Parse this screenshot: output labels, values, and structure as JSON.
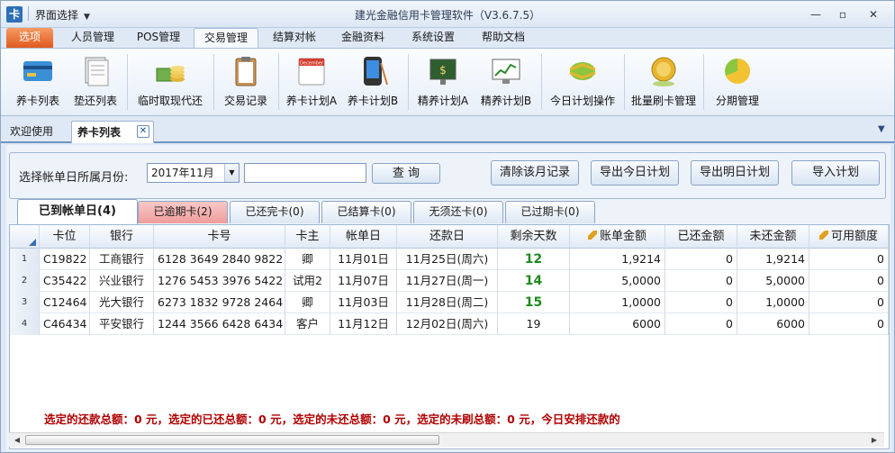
{
  "titlebar": {
    "switcher_label": "界面选择",
    "app_title": "建光金融信用卡管理软件（V3.6.7.5）",
    "icon_glyph": "卡"
  },
  "menu": {
    "options": "选项",
    "items": [
      "人员管理",
      "POS管理",
      "交易管理",
      "结算对帐",
      "金融资料",
      "系统设置",
      "帮助文档"
    ],
    "active": "交易管理"
  },
  "ribbon": [
    {
      "label": "养卡列表",
      "icon": "credit-card-icon"
    },
    {
      "label": "垫还列表",
      "icon": "document-stack-icon"
    },
    {
      "label": "临时取现代还",
      "icon": "coins-cash-icon"
    },
    {
      "label": "交易记录",
      "icon": "clipboard-icon"
    },
    {
      "label": "养卡计划A",
      "icon": "calendar-icon",
      "badge": "December"
    },
    {
      "label": "养卡计划B",
      "icon": "pda-device-icon"
    },
    {
      "label": "精养计划A",
      "icon": "money-board-icon"
    },
    {
      "label": "精养计划B",
      "icon": "chart-monitor-icon"
    },
    {
      "label": "今日计划操作",
      "icon": "refresh-arrows-icon"
    },
    {
      "label": "批量刷卡管理",
      "icon": "gold-coin-icon"
    },
    {
      "label": "分期管理",
      "icon": "pie-chart-icon"
    }
  ],
  "doc_tabs": {
    "welcome": "欢迎使用",
    "active": "养卡列表",
    "close": "✕"
  },
  "filter": {
    "label": "选择帐单日所属月份:",
    "month_value": "2017年11月",
    "search_value": "",
    "query_button": "查 询",
    "buttons": [
      "清除该月记录",
      "导出今日计划",
      "导出明日计划",
      "导入计划"
    ]
  },
  "status_tabs": [
    {
      "label": "已到帐单日(4)",
      "state": "active"
    },
    {
      "label": "已逾期卡(2)",
      "state": "overdue"
    },
    {
      "label": "已还完卡(0)",
      "state": "normal"
    },
    {
      "label": "已结算卡(0)",
      "state": "normal"
    },
    {
      "label": "无须还卡(0)",
      "state": "normal"
    },
    {
      "label": "已过期卡(0)",
      "state": "normal"
    }
  ],
  "table": {
    "columns": [
      "卡位",
      "银行",
      "卡号",
      "卡主",
      "帐单日",
      "还款日",
      "剩余天数",
      "账单金额",
      "已还金额",
      "未还金额",
      "可用额度"
    ],
    "rows": [
      {
        "no": "1",
        "slot": "C19822",
        "bank": "工商银行",
        "card": "6128 3649 2840 9822",
        "owner": "卿",
        "bill_day": "11月01日",
        "due_day": "11月25日(周六)",
        "days": "12",
        "bill_amt": "1,9214",
        "paid": "0",
        "unpaid": "1,9214",
        "avail": "0",
        "highlight": true
      },
      {
        "no": "2",
        "slot": "C35422",
        "bank": "兴业银行",
        "card": "1276 5453 3976 5422",
        "owner": "试用2",
        "bill_day": "11月07日",
        "due_day": "11月27日(周一)",
        "days": "14",
        "bill_amt": "5,0000",
        "paid": "0",
        "unpaid": "5,0000",
        "avail": "0",
        "highlight": true
      },
      {
        "no": "3",
        "slot": "C12464",
        "bank": "光大银行",
        "card": "6273 1832 9728 2464",
        "owner": "卿",
        "bill_day": "11月03日",
        "due_day": "11月28日(周二)",
        "days": "15",
        "bill_amt": "1,0000",
        "paid": "0",
        "unpaid": "1,0000",
        "avail": "0",
        "highlight": true
      },
      {
        "no": "4",
        "slot": "C46434",
        "bank": "平安银行",
        "card": "1244 3566 6428 6434",
        "owner": "客户",
        "bill_day": "11月12日",
        "due_day": "12月02日(周六)",
        "days": "19",
        "bill_amt": "6000",
        "paid": "0",
        "unpaid": "6000",
        "avail": "0",
        "highlight": false
      }
    ]
  },
  "summary": "选定的还款总额：0 元，选定的已还总额：0 元，选定的未还总额：0 元，选定的未刷总额：0 元，今日安排还款的",
  "colors": {
    "accent": "#e15a1f",
    "overdue": "#ef9c9c",
    "days_green": "#1e8a1e",
    "summary_red": "#b00000"
  }
}
